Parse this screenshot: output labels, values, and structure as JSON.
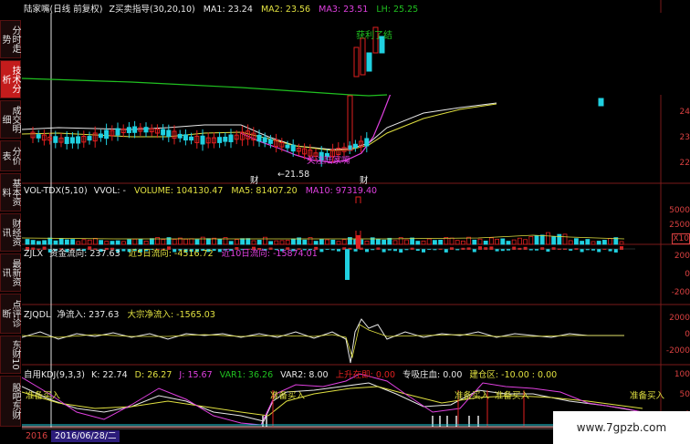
{
  "sidebar": {
    "tabs": [
      {
        "label": "分时走势",
        "active": false
      },
      {
        "label": "技术分析",
        "active": true
      },
      {
        "label": "成交明细",
        "active": false
      },
      {
        "label": "分价表",
        "active": false
      },
      {
        "label": "基本资料",
        "active": false
      },
      {
        "label": "财经资讯",
        "active": false
      },
      {
        "label": "最新资讯",
        "active": false
      },
      {
        "label": "点评诊断",
        "active": false
      },
      {
        "label": "东财10",
        "active": false
      },
      {
        "label": "股吧东财",
        "active": false
      }
    ]
  },
  "main_panel": {
    "title": "陆家嘴(日线 前复权)",
    "indicator": "Z买卖指导(30,20,10)",
    "ma1": "MA1: 23.24",
    "ma2": "MA2: 23.56",
    "ma3": "MA3: 23.51",
    "lh": "LH: 25.25",
    "annot_profit": "获利了结",
    "annot_low": "←21.58",
    "annot_fin": "财",
    "annot_fin2": "财",
    "annot_mid": "关注陆家嘴",
    "axis": [
      "24",
      "23",
      "22"
    ]
  },
  "vol_panel": {
    "name": "VOL-TDX(5,10)",
    "vvol": "VVOL: -",
    "volume": "VOLUME: 104130.47",
    "ma5": "MA5: 81407.20",
    "ma10": "MA10: 97319.40",
    "axis": [
      "5000",
      "2500",
      "X10"
    ]
  },
  "zjlx_panel": {
    "name": "ZJLX",
    "flow": "资金流向: 237.63",
    "flow5": "近5日流向: -4516.72",
    "flow10": "近10日流向: -15874.01",
    "axis": [
      "200",
      "0",
      "-200"
    ]
  },
  "zjqdl_panel": {
    "name": "ZJQDL",
    "net": "净流入: 237.63",
    "big": "大宗净流入: -1565.03",
    "axis": [
      "2000",
      "0",
      "-2000"
    ]
  },
  "kdj_panel": {
    "name": "自用KDJ(9,3,3)",
    "k": "K: 22.74",
    "d": "D: 26.27",
    "j": "J: 15.67",
    "var1": "VAR1: 36.26",
    "var2": "VAR2: 8.00",
    "rise": "上升在即: 0.00",
    "absorb": "专吸庄血: 0.00",
    "build": "建仓区: -10.00 : 0.00",
    "prep": "准备买入",
    "axis": [
      "100",
      "50",
      "0"
    ]
  },
  "datebar": {
    "year": "2016",
    "date": "2016/06/28/二"
  },
  "watermark": "www.7gpzb.com",
  "colors": {
    "up": "#e02020",
    "down": "#20d0e0",
    "ma_white": "#e8e8e8",
    "ma_yellow": "#e0e040",
    "ma_magenta": "#e040e0",
    "ma_green": "#20c020"
  }
}
